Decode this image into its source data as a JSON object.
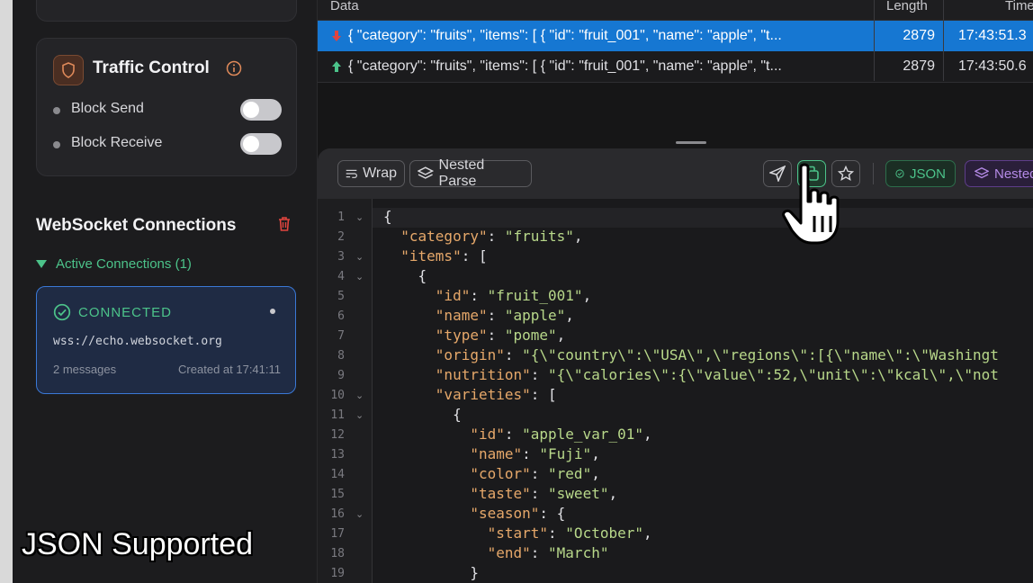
{
  "sidebar": {
    "traffic_control": {
      "title": "Traffic Control",
      "rows": [
        {
          "label": "Block Send",
          "enabled": false
        },
        {
          "label": "Block Receive",
          "enabled": false
        }
      ]
    },
    "websocket": {
      "title": "WebSocket Connections",
      "active_label": "Active Connections (1)",
      "connection": {
        "status": "CONNECTED",
        "url": "wss://echo.websocket.org",
        "messages": "2 messages",
        "created": "Created at 17:41:11"
      }
    }
  },
  "caption": "JSON Supported",
  "table": {
    "headers": {
      "data": "Data",
      "length": "Length",
      "time": "Time"
    },
    "rows": [
      {
        "direction": "received",
        "data": "{ \"category\": \"fruits\", \"items\": [ { \"id\": \"fruit_001\", \"name\": \"apple\", \"t...",
        "length": "2879",
        "time": "17:43:51.3"
      },
      {
        "direction": "sent",
        "data": "{ \"category\": \"fruits\", \"items\": [ { \"id\": \"fruit_001\", \"name\": \"apple\", \"t...",
        "length": "2879",
        "time": "17:43:50.6"
      }
    ]
  },
  "toolbar": {
    "wrap_label": "Wrap",
    "nested_parse_label": "Nested Parse",
    "json_label": "JSON",
    "nested_label": "Nested"
  },
  "code": {
    "line_numbers": [
      "1",
      "2",
      "3",
      "4",
      "5",
      "6",
      "7",
      "8",
      "9",
      "10",
      "11",
      "12",
      "13",
      "14",
      "15",
      "16",
      "17",
      "18",
      "19"
    ],
    "lines": [
      "{",
      "  \"category\": \"fruits\",",
      "  \"items\": [",
      "    {",
      "      \"id\": \"fruit_001\",",
      "      \"name\": \"apple\",",
      "      \"type\": \"pome\",",
      "      \"origin\": \"{\\\"country\\\":\\\"USA\\\",\\\"regions\\\":[{\\\"name\\\":\\\"Washingt",
      "      \"nutrition\": \"{\\\"calories\\\":{\\\"value\\\":52,\\\"unit\\\":\\\"kcal\\\",\\\"not",
      "      \"varieties\": [",
      "        {",
      "          \"id\": \"apple_var_01\",",
      "          \"name\": \"Fuji\",",
      "          \"color\": \"red\",",
      "          \"taste\": \"sweet\",",
      "          \"season\": {",
      "            \"start\": \"October\",",
      "            \"end\": \"March\"",
      "          }"
    ],
    "folds": [
      "1",
      "3",
      "4",
      "10",
      "11",
      "16"
    ]
  },
  "colors": {
    "accent_blue": "#1677d2",
    "connected_green": "#4cc38a",
    "key_orange": "#e6a86a",
    "string_green": "#b8d88a"
  }
}
